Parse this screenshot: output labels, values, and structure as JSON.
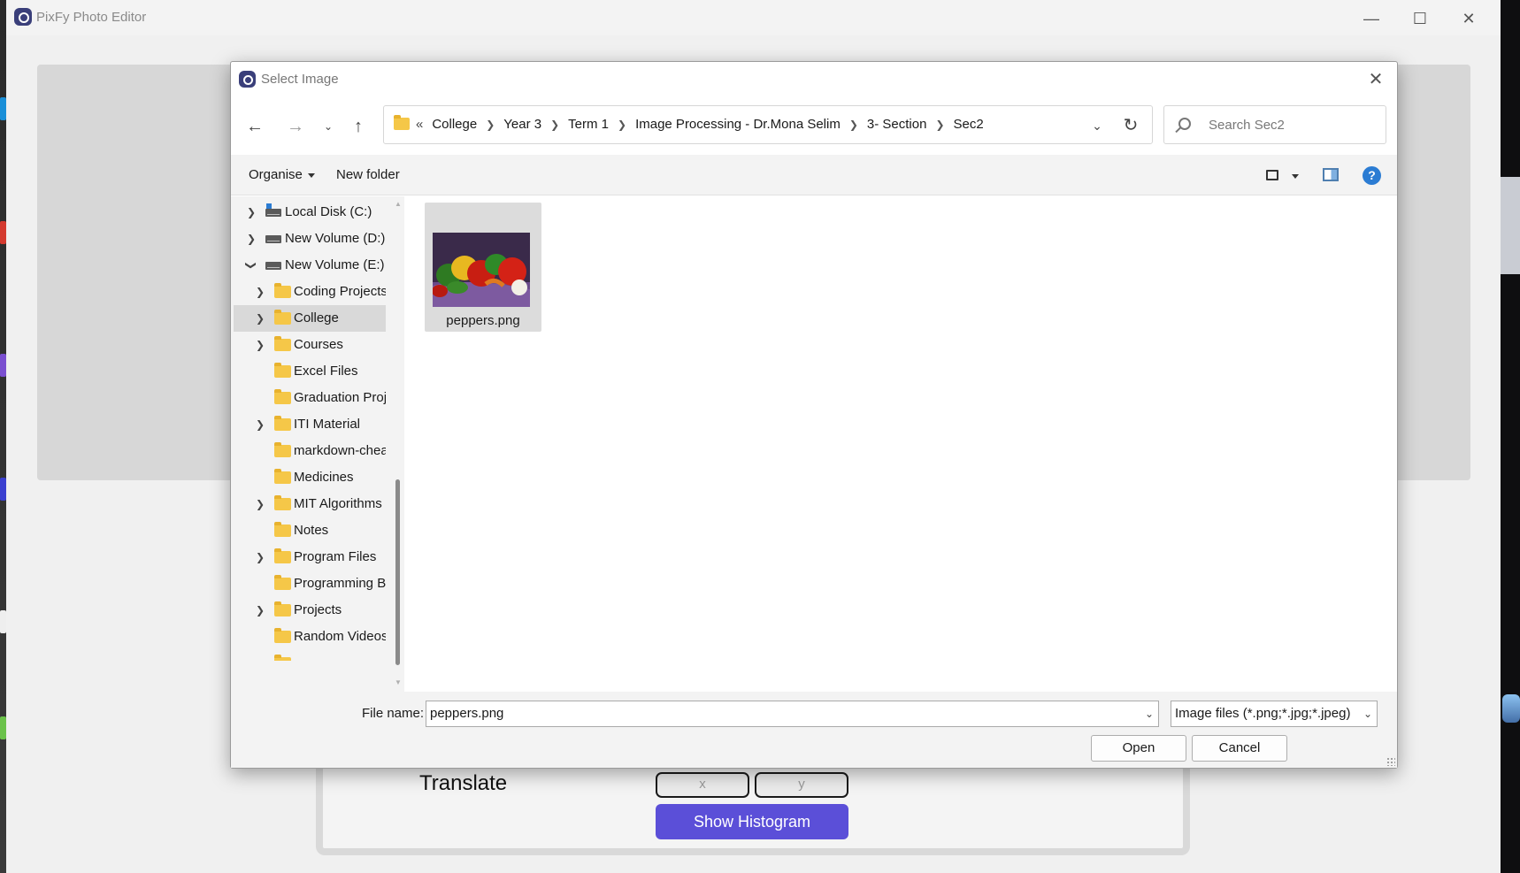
{
  "app": {
    "title": "PixFy Photo Editor",
    "translate_label": "Translate",
    "x_placeholder": "x",
    "y_placeholder": "y",
    "histogram_button": "Show Histogram",
    "accent_color": "#5b4fd8"
  },
  "dialog": {
    "title": "Select Image",
    "breadcrumbs": [
      "College",
      "Year 3",
      "Term 1",
      "Image Processing - Dr.Mona Selim",
      "3- Section",
      "Sec2"
    ],
    "search_placeholder": "Search Sec2",
    "toolbar": {
      "organise": "Organise",
      "new_folder": "New folder"
    },
    "tree": [
      {
        "label": "Local Disk (C:)",
        "icon": "drive-icon",
        "chevron": "right",
        "level": 0
      },
      {
        "label": "New Volume (D:)",
        "icon": "drive-icon",
        "chevron": "right",
        "level": 0
      },
      {
        "label": "New Volume (E:)",
        "icon": "drive-icon",
        "chevron": "down",
        "level": 0
      },
      {
        "label": "Coding Projects",
        "icon": "folder-icon",
        "chevron": "right",
        "level": 1
      },
      {
        "label": "College",
        "icon": "folder-icon",
        "chevron": "right",
        "level": 1,
        "selected": true
      },
      {
        "label": "Courses",
        "icon": "folder-icon",
        "chevron": "right",
        "level": 1
      },
      {
        "label": "Excel Files",
        "icon": "folder-icon",
        "chevron": "none",
        "level": 1
      },
      {
        "label": "Graduation Project",
        "icon": "folder-icon",
        "chevron": "none",
        "level": 1
      },
      {
        "label": "ITI Material",
        "icon": "folder-icon",
        "chevron": "right",
        "level": 1
      },
      {
        "label": "markdown-cheatsheet",
        "icon": "folder-icon",
        "chevron": "none",
        "level": 1
      },
      {
        "label": "Medicines",
        "icon": "folder-icon",
        "chevron": "none",
        "level": 1
      },
      {
        "label": "MIT Algorithms",
        "icon": "folder-icon",
        "chevron": "right",
        "level": 1
      },
      {
        "label": "Notes",
        "icon": "folder-icon",
        "chevron": "none",
        "level": 1
      },
      {
        "label": "Program Files",
        "icon": "folder-icon",
        "chevron": "right",
        "level": 1
      },
      {
        "label": "Programming Books",
        "icon": "folder-icon",
        "chevron": "none",
        "level": 1
      },
      {
        "label": "Projects",
        "icon": "folder-icon",
        "chevron": "right",
        "level": 1
      },
      {
        "label": "Random Videos",
        "icon": "folder-icon",
        "chevron": "none",
        "level": 1
      }
    ],
    "files": [
      {
        "name": "peppers.png"
      }
    ],
    "file_name_label": "File name:",
    "file_name_value": "peppers.png",
    "file_type": "Image files (*.png;*.jpg;*.jpeg)",
    "open_button": "Open",
    "cancel_button": "Cancel"
  }
}
